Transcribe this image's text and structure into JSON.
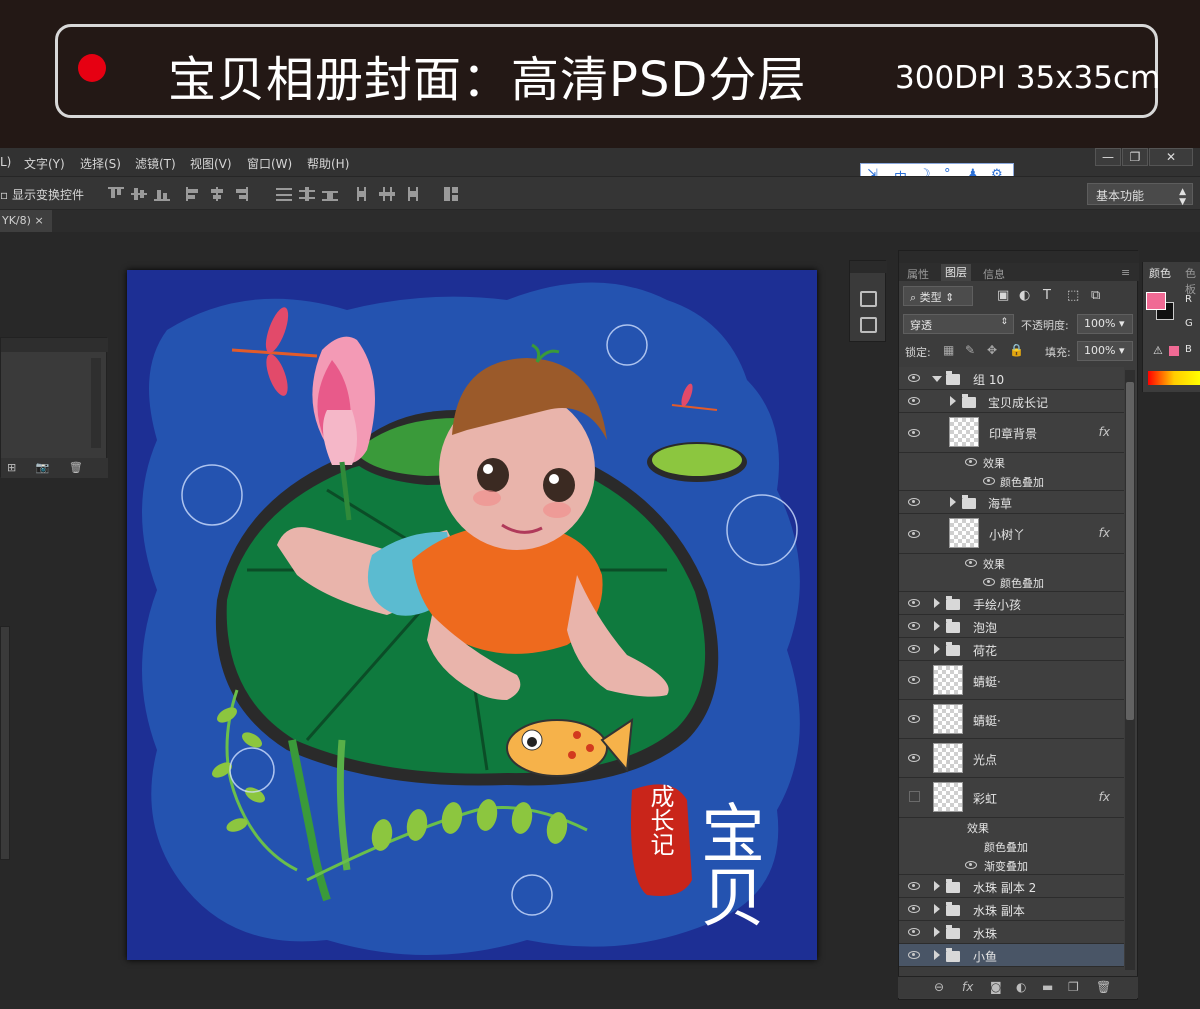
{
  "banner": {
    "title": "宝贝相册封面：高清PSD分层",
    "spec": "300DPI 35x35cm"
  },
  "menu": {
    "items": [
      "L)",
      "文字(Y)",
      "选择(S)",
      "滤镜(T)",
      "视图(V)",
      "窗口(W)",
      "帮助(H)"
    ]
  },
  "window_controls": [
    "—",
    "❐",
    "✕"
  ],
  "ime": {
    "mode": "中"
  },
  "options": {
    "show_transform_label": "显示变换控件",
    "workspace": "基本功能"
  },
  "document_tab": {
    "label": "YK/8)",
    "close": "×"
  },
  "artwork": {
    "logo_text": "宝贝",
    "stamp_text": "成长记"
  },
  "layers_panel": {
    "tabs": [
      "属性",
      "图层",
      "信息"
    ],
    "filter_kind": "类型",
    "blend_mode": "穿透",
    "opacity_label": "不透明度:",
    "opacity_value": "100%",
    "lock_label": "锁定:",
    "fill_label": "填充:",
    "fill_value": "100%",
    "layers": [
      {
        "name": "组 10",
        "type": "group-open",
        "visible": true
      },
      {
        "name": "宝贝成长记",
        "type": "group",
        "visible": true
      },
      {
        "name": "印章背景",
        "type": "layer-fx",
        "visible": true
      },
      {
        "name": "效果",
        "type": "effect",
        "visible": true
      },
      {
        "name": "颜色叠加",
        "type": "effect-item",
        "visible": true
      },
      {
        "name": "海草",
        "type": "group",
        "visible": true
      },
      {
        "name": "小树丫",
        "type": "layer-fx",
        "visible": true
      },
      {
        "name": "效果",
        "type": "effect",
        "visible": true
      },
      {
        "name": "颜色叠加",
        "type": "effect-item",
        "visible": true
      },
      {
        "name": "手绘小孩",
        "type": "group",
        "visible": true
      },
      {
        "name": "泡泡",
        "type": "group",
        "visible": true
      },
      {
        "name": "荷花",
        "type": "group",
        "visible": true
      },
      {
        "name": "蜻蜓·",
        "type": "layer",
        "visible": true
      },
      {
        "name": "蜻蜓·",
        "type": "layer",
        "visible": true
      },
      {
        "name": "光点",
        "type": "layer",
        "visible": true
      },
      {
        "name": "彩虹",
        "type": "layer-fx",
        "visible": false
      },
      {
        "name": "效果",
        "type": "effect",
        "visible": false
      },
      {
        "name": "颜色叠加",
        "type": "effect-item",
        "visible": false
      },
      {
        "name": "渐变叠加",
        "type": "effect-item",
        "visible": false
      },
      {
        "name": "水珠 副本 2",
        "type": "group",
        "visible": true
      },
      {
        "name": "水珠 副本",
        "type": "group",
        "visible": true
      },
      {
        "name": "水珠",
        "type": "group",
        "visible": true
      },
      {
        "name": "小鱼",
        "type": "group",
        "visible": true,
        "selected": true
      }
    ]
  },
  "color_panel": {
    "tabs": [
      "颜色",
      "色板"
    ],
    "channels": [
      "R",
      "G",
      "B"
    ],
    "foreground": "#f06a94",
    "background": "#111111"
  }
}
